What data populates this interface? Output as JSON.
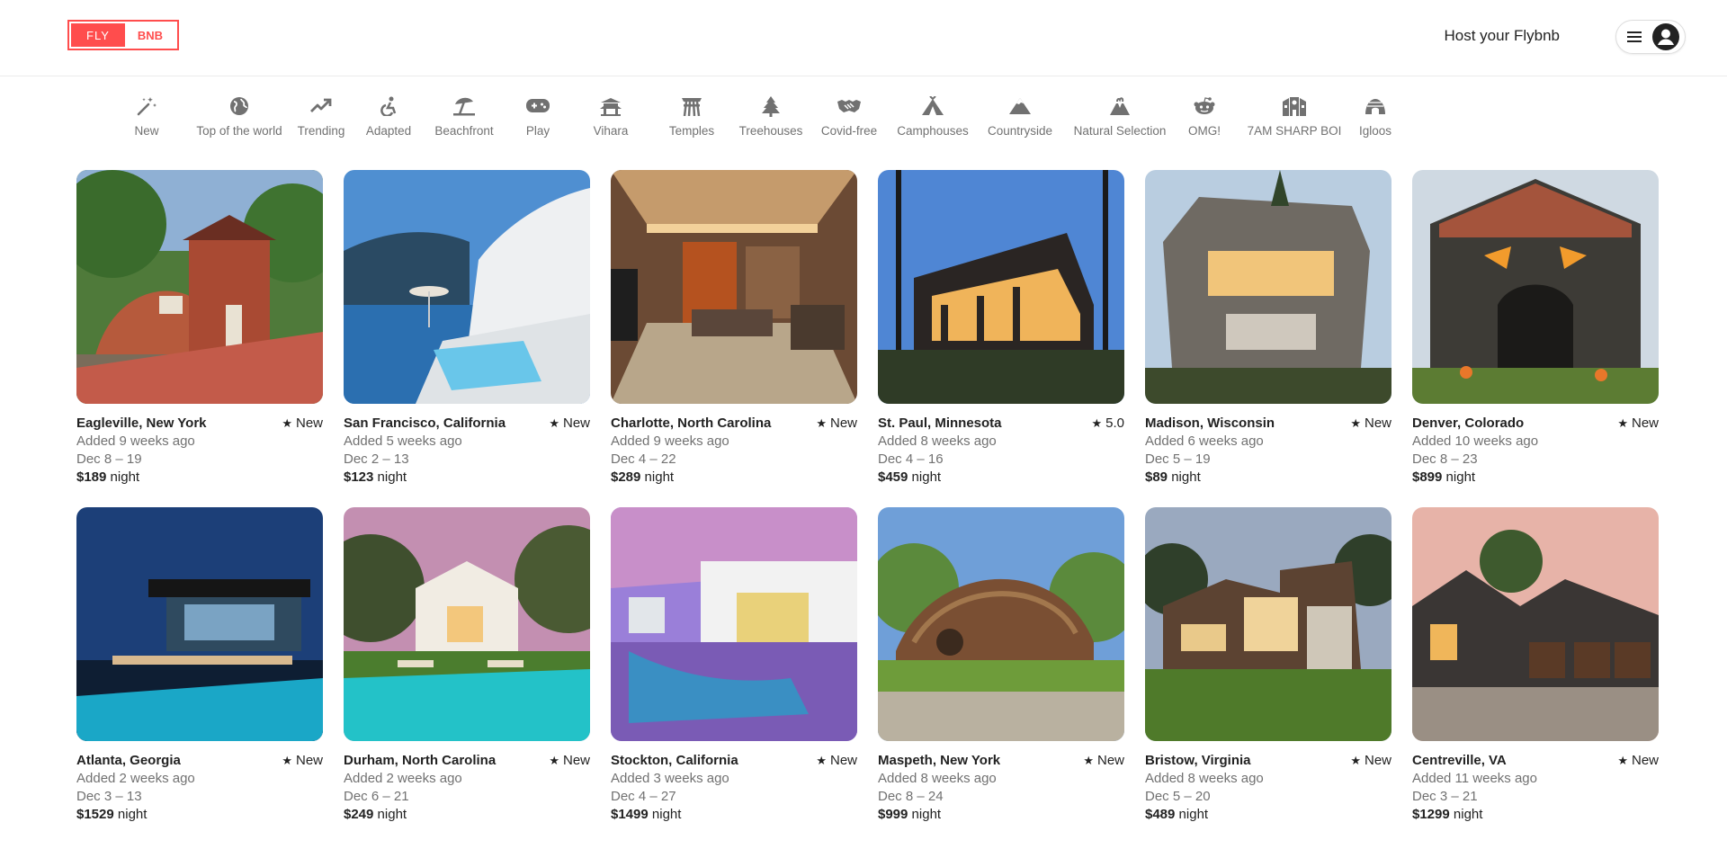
{
  "brand": {
    "left": "FLY",
    "right": "BNB"
  },
  "header": {
    "host_link": "Host your Flybnb"
  },
  "categories": [
    {
      "label": "New",
      "icon": "magic-wand-icon"
    },
    {
      "label": "Top of the world",
      "icon": "globe-icon"
    },
    {
      "label": "Trending",
      "icon": "trending-icon"
    },
    {
      "label": "Adapted",
      "icon": "accessible-icon"
    },
    {
      "label": "Beachfront",
      "icon": "umbrella-beach-icon"
    },
    {
      "label": "Play",
      "icon": "gamepad-icon"
    },
    {
      "label": "Vihara",
      "icon": "vihara-icon"
    },
    {
      "label": "Temples",
      "icon": "torii-gate-icon"
    },
    {
      "label": "Treehouses",
      "icon": "tree-icon"
    },
    {
      "label": "Covid-free",
      "icon": "handshake-icon"
    },
    {
      "label": "Camphouses",
      "icon": "tent-icon"
    },
    {
      "label": "Countryside",
      "icon": "mountain-icon"
    },
    {
      "label": "Natural Selection",
      "icon": "volcano-icon"
    },
    {
      "label": "OMG!",
      "icon": "reddit-icon"
    },
    {
      "label": "7AM SHARP BOI",
      "icon": "school-icon"
    },
    {
      "label": "Igloos",
      "icon": "igloo-icon"
    }
  ],
  "listings": [
    {
      "location": "Eagleville, New York",
      "rating": "New",
      "added": "Added 9 weeks ago",
      "dates": "Dec 8 – 19",
      "price": "$189",
      "unit": "night"
    },
    {
      "location": "San Francisco, California",
      "rating": "New",
      "added": "Added 5 weeks ago",
      "dates": "Dec 2 – 13",
      "price": "$123",
      "unit": "night"
    },
    {
      "location": "Charlotte, North Carolina",
      "rating": "New",
      "added": "Added 9 weeks ago",
      "dates": "Dec 4 – 22",
      "price": "$289",
      "unit": "night"
    },
    {
      "location": "St. Paul, Minnesota",
      "rating": "5.0",
      "added": "Added 8 weeks ago",
      "dates": "Dec 4 – 16",
      "price": "$459",
      "unit": "night"
    },
    {
      "location": "Madison, Wisconsin",
      "rating": "New",
      "added": "Added 6 weeks ago",
      "dates": "Dec 5 – 19",
      "price": "$89",
      "unit": "night"
    },
    {
      "location": "Denver, Colorado",
      "rating": "New",
      "added": "Added 10 weeks ago",
      "dates": "Dec 8 – 23",
      "price": "$899",
      "unit": "night"
    },
    {
      "location": "Atlanta, Georgia",
      "rating": "New",
      "added": "Added 2 weeks ago",
      "dates": "Dec 3 – 13",
      "price": "$1529",
      "unit": "night"
    },
    {
      "location": "Durham, North Carolina",
      "rating": "New",
      "added": "Added 2 weeks ago",
      "dates": "Dec 6 – 21",
      "price": "$249",
      "unit": "night"
    },
    {
      "location": "Stockton, California",
      "rating": "New",
      "added": "Added 3 weeks ago",
      "dates": "Dec 4 – 27",
      "price": "$1499",
      "unit": "night"
    },
    {
      "location": "Maspeth, New York",
      "rating": "New",
      "added": "Added 8 weeks ago",
      "dates": "Dec 8 – 24",
      "price": "$999",
      "unit": "night"
    },
    {
      "location": "Bristow, Virginia",
      "rating": "New",
      "added": "Added 8 weeks ago",
      "dates": "Dec 5 – 20",
      "price": "$489",
      "unit": "night"
    },
    {
      "location": "Centreville, VA",
      "rating": "New",
      "added": "Added 11 weeks ago",
      "dates": "Dec 3 – 21",
      "price": "$1299",
      "unit": "night"
    }
  ],
  "colors": {
    "brand": "#ff4d4d",
    "muted": "#717171",
    "text": "#222222"
  }
}
